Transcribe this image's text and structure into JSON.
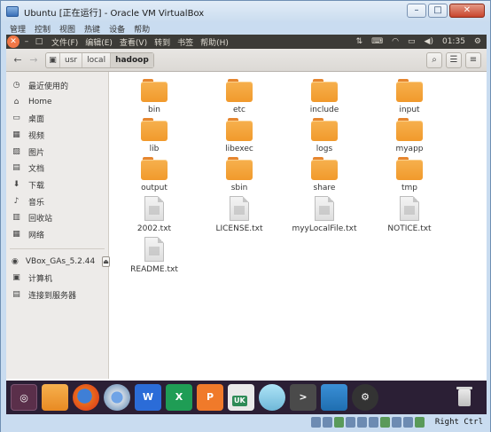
{
  "vbox": {
    "title": "Ubuntu [正在运行] - Oracle VM VirtualBox",
    "menu": [
      "管理",
      "控制",
      "视图",
      "热键",
      "设备",
      "帮助"
    ],
    "host_key": "Right Ctrl"
  },
  "ubuntu_panel": {
    "close_glyph": "✕",
    "menu": [
      "文件(F)",
      "编辑(E)",
      "查看(V)",
      "转到",
      "书签",
      "帮助(H)"
    ],
    "time": "01:35"
  },
  "toolbar": {
    "breadcrumb_root_icon": "drive-icon",
    "breadcrumbs": [
      "usr",
      "local",
      "hadoop"
    ]
  },
  "sidebar": {
    "places": [
      {
        "label": "最近使用的",
        "icon": "clock-icon"
      },
      {
        "label": "Home",
        "icon": "home-icon"
      },
      {
        "label": "桌面",
        "icon": "desktop-icon"
      },
      {
        "label": "视频",
        "icon": "video-icon"
      },
      {
        "label": "图片",
        "icon": "picture-icon"
      },
      {
        "label": "文档",
        "icon": "document-icon"
      },
      {
        "label": "下载",
        "icon": "download-icon"
      },
      {
        "label": "音乐",
        "icon": "music-icon"
      },
      {
        "label": "回收站",
        "icon": "trash-icon"
      },
      {
        "label": "网络",
        "icon": "network-icon"
      }
    ],
    "devices": [
      {
        "label": "VBox_GAs_5.2.44",
        "icon": "disc-icon"
      },
      {
        "label": "计算机",
        "icon": "computer-icon"
      },
      {
        "label": "连接到服务器",
        "icon": "server-icon"
      }
    ]
  },
  "files": [
    {
      "name": "bin",
      "type": "folder"
    },
    {
      "name": "etc",
      "type": "folder"
    },
    {
      "name": "include",
      "type": "folder"
    },
    {
      "name": "input",
      "type": "folder"
    },
    {
      "name": "lib",
      "type": "folder"
    },
    {
      "name": "libexec",
      "type": "folder"
    },
    {
      "name": "logs",
      "type": "folder"
    },
    {
      "name": "myapp",
      "type": "folder"
    },
    {
      "name": "output",
      "type": "folder"
    },
    {
      "name": "sbin",
      "type": "folder"
    },
    {
      "name": "share",
      "type": "folder"
    },
    {
      "name": "tmp",
      "type": "folder"
    },
    {
      "name": "2002.txt",
      "type": "text"
    },
    {
      "name": "LICENSE.txt",
      "type": "text"
    },
    {
      "name": "myyLocalFile.txt",
      "type": "text"
    },
    {
      "name": "NOTICE.txt",
      "type": "text"
    },
    {
      "name": "README.txt",
      "type": "text"
    }
  ],
  "dock": {
    "ustore_badge": "UK"
  }
}
